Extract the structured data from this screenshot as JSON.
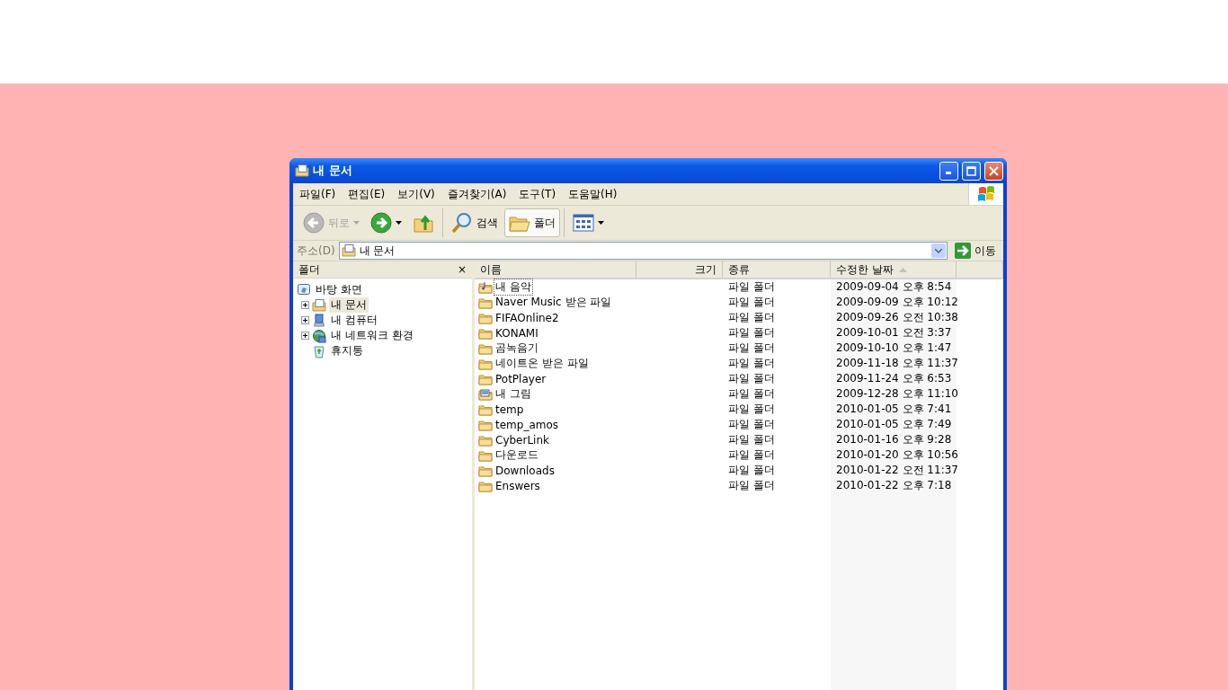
{
  "window": {
    "title": "내 문서"
  },
  "menu": [
    {
      "label": "파일(F)"
    },
    {
      "label": "편집(E)"
    },
    {
      "label": "보기(V)"
    },
    {
      "label": "즐겨찾기(A)"
    },
    {
      "label": "도구(T)"
    },
    {
      "label": "도움말(H)"
    }
  ],
  "toolbar": [
    {
      "kind": "back",
      "label": "뒤로",
      "disabled": true,
      "pressed": false,
      "dropdown": true
    },
    {
      "kind": "forward",
      "disabled": false,
      "pressed": false,
      "dropdown": true
    },
    {
      "kind": "up",
      "disabled": false,
      "pressed": false,
      "dropdown": false
    },
    {
      "kind": "search",
      "label": "검색",
      "disabled": false,
      "pressed": false,
      "dropdown": false
    },
    {
      "kind": "folders",
      "label": "폴더",
      "disabled": false,
      "pressed": true,
      "dropdown": false
    },
    {
      "kind": "views",
      "disabled": false,
      "pressed": false,
      "dropdown": true
    }
  ],
  "address": {
    "label": "주소(D)",
    "value": "내 문서",
    "go": "이동"
  },
  "folder_pane": {
    "title": "폴더",
    "close": "×"
  },
  "tree": [
    {
      "label": "바탕 화면",
      "kind": "desktop",
      "selected": false,
      "children": [
        {
          "label": "내 문서",
          "kind": "documents",
          "selected": true,
          "expanded": false
        },
        {
          "label": "내 컴퓨터",
          "kind": "computer",
          "selected": false,
          "expanded": false
        },
        {
          "label": "내 네트워크 환경",
          "kind": "network",
          "selected": false,
          "expanded": false
        },
        {
          "label": "휴지통",
          "kind": "recycle",
          "selected": false
        }
      ]
    }
  ],
  "columns": [
    {
      "label": "이름",
      "sorted": false
    },
    {
      "label": "크기",
      "sorted": false
    },
    {
      "label": "종류",
      "sorted": false
    },
    {
      "label": "수정한 날짜",
      "sorted": true
    }
  ],
  "rows": [
    {
      "name": "내 음악",
      "kind": "music",
      "type": "파일 폴더",
      "modified": "2009-09-04 오후 8:54",
      "focused": true
    },
    {
      "name": "Naver Music 받은 파일",
      "kind": "folder",
      "type": "파일 폴더",
      "modified": "2009-09-09 오후 10:12",
      "focused": false
    },
    {
      "name": "FIFAOnline2",
      "kind": "folder",
      "type": "파일 폴더",
      "modified": "2009-09-26 오전 10:38",
      "focused": false
    },
    {
      "name": "KONAMI",
      "kind": "folder",
      "type": "파일 폴더",
      "modified": "2009-10-01 오전 3:37",
      "focused": false
    },
    {
      "name": "곰녹음기",
      "kind": "folder",
      "type": "파일 폴더",
      "modified": "2009-10-10 오후 1:47",
      "focused": false
    },
    {
      "name": "네이트온 받은 파일",
      "kind": "folder",
      "type": "파일 폴더",
      "modified": "2009-11-18 오후 11:37",
      "focused": false
    },
    {
      "name": "PotPlayer",
      "kind": "folder",
      "type": "파일 폴더",
      "modified": "2009-11-24 오후 6:53",
      "focused": false
    },
    {
      "name": "내 그림",
      "kind": "pictures",
      "type": "파일 폴더",
      "modified": "2009-12-28 오후 11:10",
      "focused": false
    },
    {
      "name": "temp",
      "kind": "folder",
      "type": "파일 폴더",
      "modified": "2010-01-05 오후 7:41",
      "focused": false
    },
    {
      "name": "temp_amos",
      "kind": "folder",
      "type": "파일 폴더",
      "modified": "2010-01-05 오후 7:49",
      "focused": false
    },
    {
      "name": "CyberLink",
      "kind": "folder",
      "type": "파일 폴더",
      "modified": "2010-01-16 오후 9:28",
      "focused": false
    },
    {
      "name": "다운로드",
      "kind": "folder",
      "type": "파일 폴더",
      "modified": "2010-01-20 오후 10:56",
      "focused": false
    },
    {
      "name": "Downloads",
      "kind": "folder",
      "type": "파일 폴더",
      "modified": "2010-01-22 오전 11:37",
      "focused": false
    },
    {
      "name": "Enswers",
      "kind": "folder",
      "type": "파일 폴더",
      "modified": "2010-01-22 오후 7:18",
      "focused": false
    }
  ]
}
